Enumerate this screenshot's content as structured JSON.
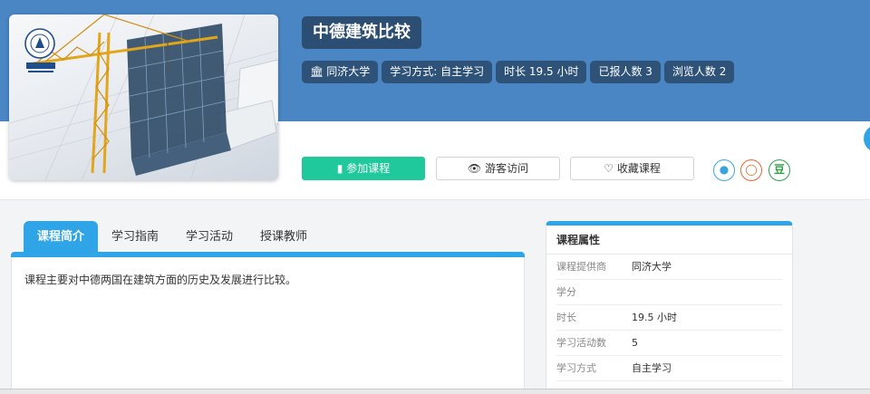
{
  "course": {
    "title": "中德建筑比较",
    "meta": [
      {
        "icon": "university-icon",
        "text": "同济大学"
      },
      {
        "text": "学习方式: 自主学习"
      },
      {
        "text": "时长 19.5 小时"
      },
      {
        "text": "已报人数 3"
      },
      {
        "text": "浏览人数 2"
      }
    ]
  },
  "actions": {
    "join": "参加课程",
    "guest": "游客访问",
    "favorite": "收藏课程"
  },
  "share": {
    "qq_icon": "qq-icon",
    "weibo_icon": "weibo-icon",
    "douban_label": "豆"
  },
  "tabs": [
    "课程简介",
    "学习指南",
    "学习活动",
    "授课教师"
  ],
  "intro": "课程主要对中德两国在建筑方面的历史及发展进行比较。",
  "attributes": {
    "title": "课程属性",
    "rows": [
      {
        "label": "课程提供商",
        "value": "同济大学"
      },
      {
        "label": "学分",
        "value": ""
      },
      {
        "label": "时长",
        "value": "19.5 小时"
      },
      {
        "label": "学习活动数",
        "value": "5"
      },
      {
        "label": "学习方式",
        "value": "自主学习"
      }
    ]
  },
  "colors": {
    "hero": "#4a86c4",
    "title_bg": "#2c4e73",
    "accent": "#2fa5e8",
    "join": "#1fc99b"
  }
}
